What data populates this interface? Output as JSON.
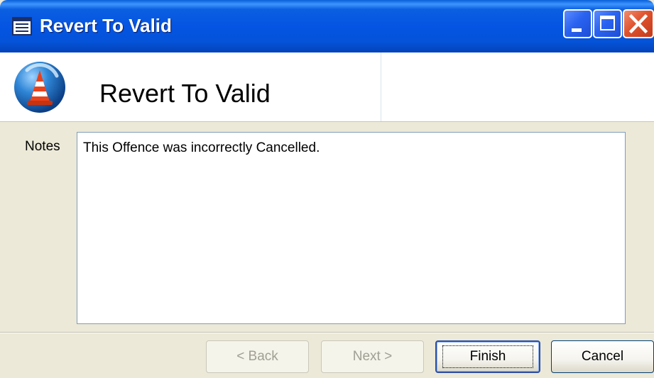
{
  "window": {
    "title": "Revert To Valid"
  },
  "header": {
    "title": "Revert To Valid"
  },
  "form": {
    "notes_label": "Notes",
    "notes_value": "This Offence was incorrectly Cancelled."
  },
  "buttons": {
    "back": "< Back",
    "next": "Next >",
    "finish": "Finish",
    "cancel": "Cancel"
  },
  "icons": {
    "window_icon": "document-list-icon",
    "header_logo": "traffic-cone-logo-icon"
  },
  "colors": {
    "titlebar": "#0554e3",
    "close_button": "#e0522e",
    "dialog_bg": "#ece9d8",
    "input_border": "#7f9db9"
  }
}
